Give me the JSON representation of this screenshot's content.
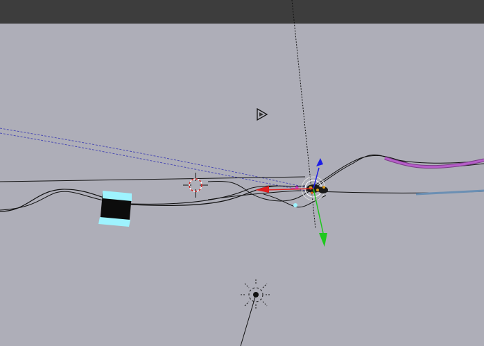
{
  "editor": {
    "type": "3d-viewport",
    "header_color": "#3d3d3d",
    "background_color": "#aeaeb8"
  },
  "colors": {
    "curve": "#111111",
    "selected_curve": "#b65ec9",
    "selected_curve_outline": "#7a3b86",
    "blue_curve": "#6b8fb3",
    "dashed_path": "#4b4bb3",
    "axis_x": "#e01e1e",
    "axis_y": "#1ec81e",
    "axis_z": "#1e1ee6",
    "cube_face": "#0c0c0c",
    "cube_edge": "#9ef3ff",
    "cursor_ring_red": "#d21e1e",
    "cursor_ring_white": "#ffffff"
  },
  "icons": {
    "camera": "camera-icon",
    "light": "sun-lamp-icon",
    "cursor_3d": "3d-cursor-icon",
    "gizmo": "transform-gizmo"
  }
}
